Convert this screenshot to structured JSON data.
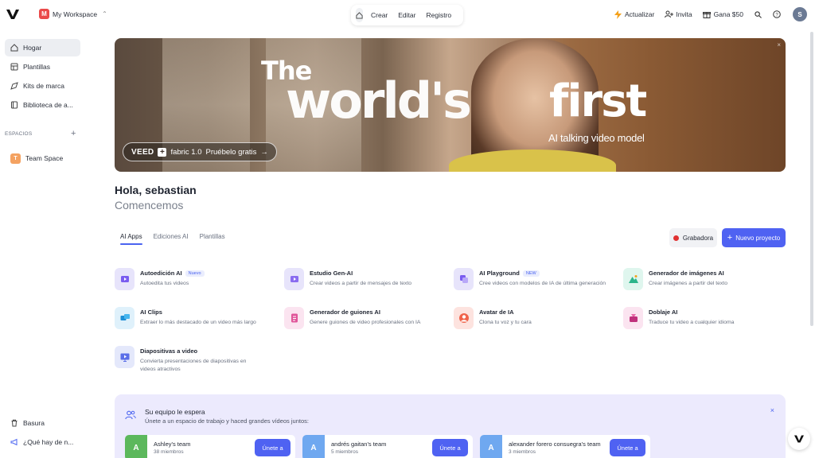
{
  "topbar": {
    "workspace_initial": "M",
    "workspace_name": "My Workspace",
    "nav": [
      "Crear",
      "Editar",
      "Registro"
    ],
    "actualizar": "Actualizar",
    "invita": "Invita",
    "gana": "Gana $50",
    "user_initial": "S"
  },
  "sidebar": {
    "items": [
      "Hogar",
      "Plantillas",
      "Kits de marca",
      "Biblioteca de a..."
    ],
    "section_label": "ESPACIOS",
    "team_initial": "T",
    "team_space": "Team Space",
    "trash": "Basura",
    "whats_new": "¿Qué hay de n..."
  },
  "banner": {
    "line1": "The",
    "line2": "world's",
    "line3": "first",
    "subtitle": "AI talking video model",
    "cta_brand": "VEED",
    "cta_product": "fabric 1.0",
    "cta_text": "Pruébelo gratis",
    "cta_arrow": "→"
  },
  "greeting": {
    "hello": "Hola, sebastian",
    "sub": "Comencemos"
  },
  "tabs": [
    "AI Apps",
    "Ediciones AI",
    "Plantillas"
  ],
  "actions": {
    "record": "Grabadora",
    "new_project": "Nuevo proyecto"
  },
  "tools": [
    {
      "title": "Autoedición AI",
      "badge": "Nuevo",
      "desc": "Autoedita tus videos"
    },
    {
      "title": "Estudio Gen-AI",
      "badge": "",
      "desc": "Crear videos a partir de mensajes de texto"
    },
    {
      "title": "AI Playground",
      "badge": "NEW",
      "desc": "Cree videos con modelos de IA de última generación"
    },
    {
      "title": "Generador de imágenes AI",
      "badge": "",
      "desc": "Crear imágenes a partir del texto"
    },
    {
      "title": "AI Clips",
      "badge": "",
      "desc": "Extraer lo más destacado de un video más largo"
    },
    {
      "title": "Generador de guiones AI",
      "badge": "",
      "desc": "Genere guiones de video profesionales con IA"
    },
    {
      "title": "Avatar de IA",
      "badge": "",
      "desc": "Clona tu voz y tu cara"
    },
    {
      "title": "Doblaje AI",
      "badge": "",
      "desc": "Traduce tu video a cualquier idioma"
    },
    {
      "title": "Diapositivas a video",
      "badge": "",
      "desc": "Convierta presentaciones de diapositivas en videos atractivos"
    }
  ],
  "team_panel": {
    "title": "Su equipo le espera",
    "sub": "Únete a un espacio de trabajo y haced grandes vídeos juntos:",
    "close": "×",
    "teams": [
      {
        "initial": "A",
        "name": "Ashley's team",
        "members": "38 miembros",
        "button": "Únete a",
        "color": "#5cb85c"
      },
      {
        "initial": "A",
        "name": "andrés gaitan's team",
        "members": "5 miembros",
        "button": "Únete a",
        "color": "#6fa8f0"
      },
      {
        "initial": "A",
        "name": "alexander forero consuegra's team",
        "members": "3 miembros",
        "button": "Únete a",
        "color": "#6fa8f0"
      }
    ]
  },
  "colors": {
    "accent": "#4f62f2",
    "record_dot": "#e03131",
    "team_panel_bg": "#eceafd"
  }
}
